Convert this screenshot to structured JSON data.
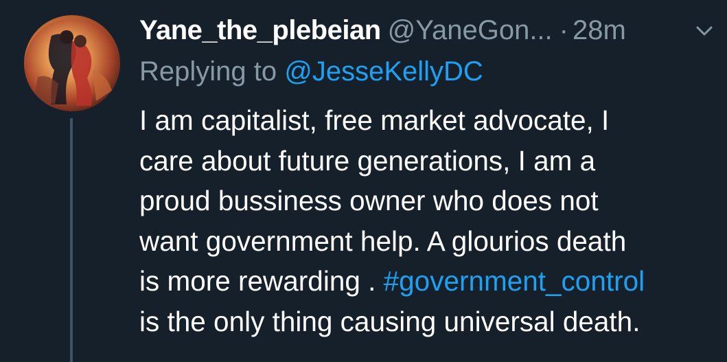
{
  "tweet": {
    "author": {
      "display_name": "Yane_the_plebeian",
      "handle": "@YaneGon...",
      "avatar_icon": "avatar-tango-dancers-painting"
    },
    "separator": "·",
    "time": "28m",
    "menu_icon": "chevron-down-icon",
    "reply": {
      "prefix": "Replying to",
      "target": "@JesseKellyDC"
    },
    "body": {
      "line1": "I am capitalist, free market advocate, I",
      "line2": "care about future generations, I am a",
      "line3": "proud bussiness owner who does not",
      "line4": "want government help. A glourios death",
      "line5_prefix": "is more rewarding . ",
      "hashtag": "#government_control",
      "line6": "is the only thing causing universal death."
    }
  },
  "colors": {
    "background": "#15202b",
    "text": "#ffffff",
    "secondary": "#8899a6",
    "link": "#1da1f2",
    "thread_line": "#3d5466"
  }
}
